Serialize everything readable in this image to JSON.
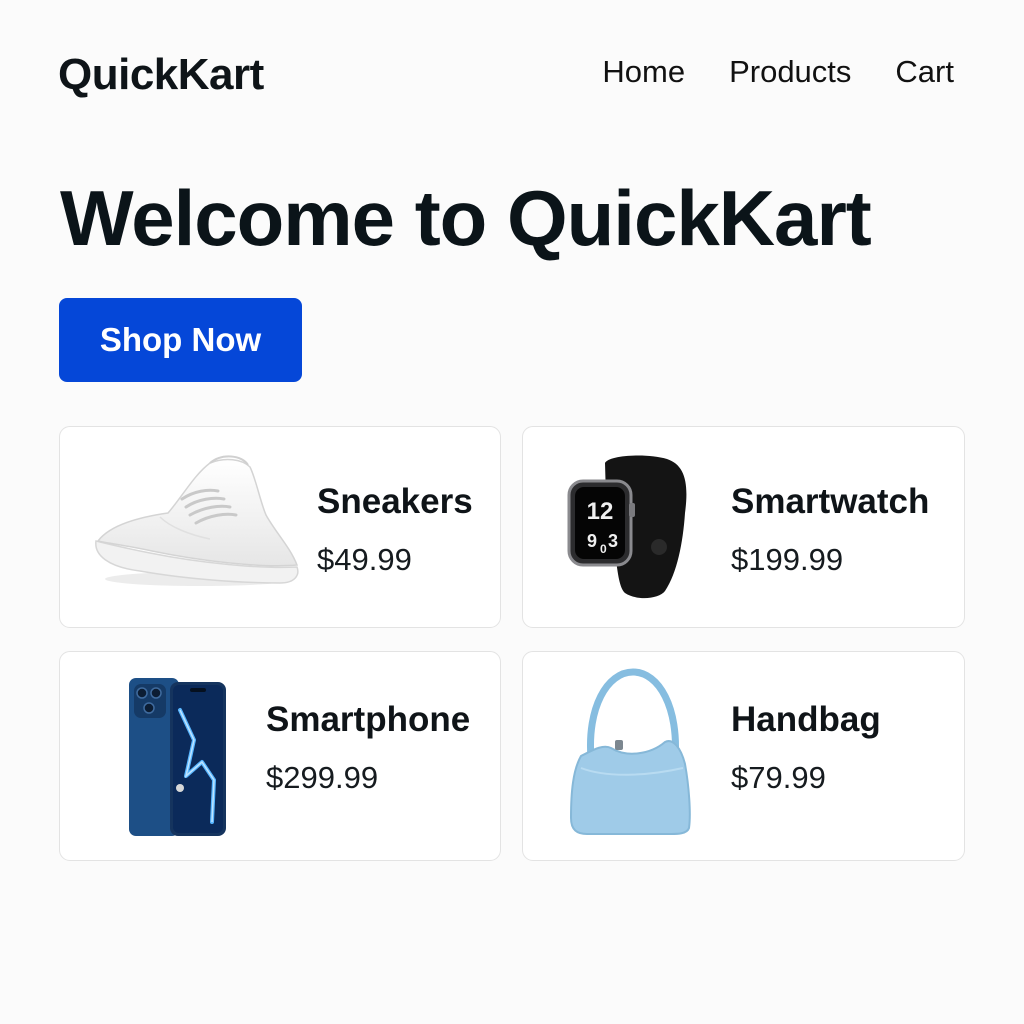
{
  "header": {
    "logo": "QuickKart",
    "nav": [
      "Home",
      "Products",
      "Cart"
    ]
  },
  "hero": {
    "title": "Welcome to QuickKart",
    "cta_label": "Shop Now"
  },
  "products": [
    {
      "name": "Sneakers",
      "price": "$49.99",
      "icon": "sneaker-image"
    },
    {
      "name": "Smartwatch",
      "price": "$199.99",
      "icon": "smartwatch-image"
    },
    {
      "name": "Smartphone",
      "price": "$299.99",
      "icon": "smartphone-image"
    },
    {
      "name": "Handbag",
      "price": "$79.99",
      "icon": "handbag-image"
    }
  ],
  "colors": {
    "accent": "#0547d8",
    "background": "#fbfbfb",
    "card_border": "#e3e3e3"
  }
}
